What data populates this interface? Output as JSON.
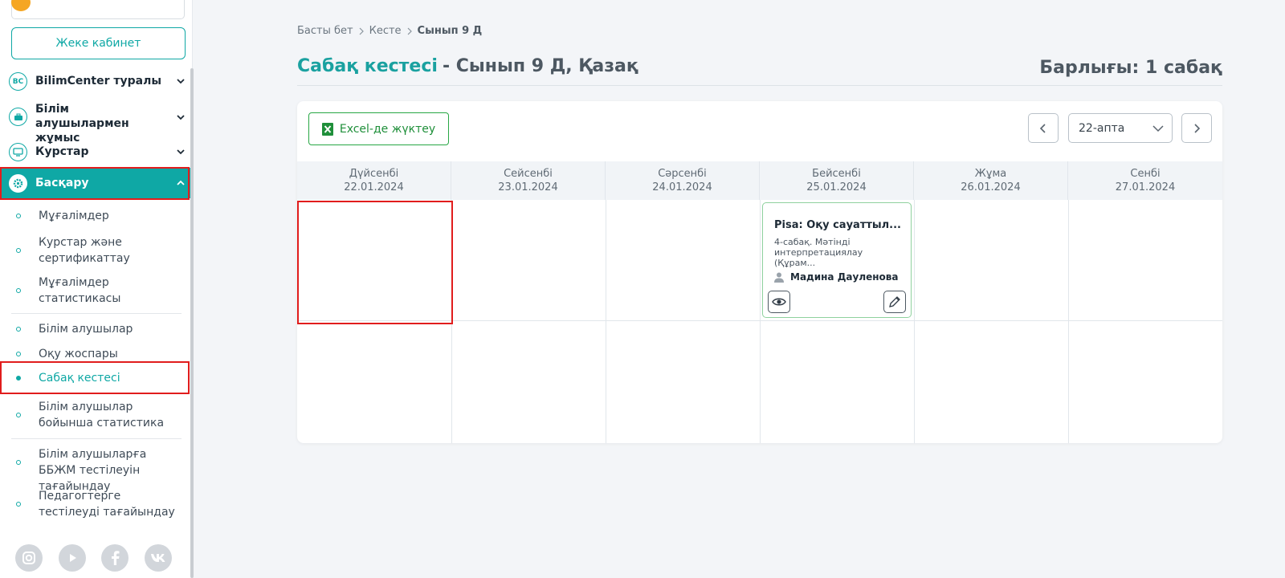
{
  "sidebar": {
    "cabinet_button": "Жеке кабинет",
    "menu": [
      {
        "label": "BilimCenter туралы",
        "icon": "bc-logo-icon"
      },
      {
        "label": "Білім алушылармен жұмыс",
        "icon": "briefcase-icon"
      },
      {
        "label": "Курстар",
        "icon": "monitor-icon"
      },
      {
        "label": "Басқару",
        "icon": "gear-icon"
      }
    ],
    "submenu_group1": [
      {
        "label": "Мұғалімдер"
      },
      {
        "label": "Курстар және сертификаттау"
      },
      {
        "label": "Мұғалімдер статистикасы"
      }
    ],
    "submenu_group2": [
      {
        "label": "Білім алушылар"
      },
      {
        "label": "Оқу жоспары"
      },
      {
        "label": "Сабақ кестесі"
      },
      {
        "label": "Білім алушылар бойынша статистика"
      }
    ],
    "submenu_group3": [
      {
        "label": "Білім алушыларға ББЖМ тестілеуін тағайындау"
      },
      {
        "label": "Педагогтерге тестілеуді тағайындау"
      }
    ],
    "social_icons": [
      "instagram-icon",
      "youtube-icon",
      "facebook-icon",
      "vk-icon"
    ]
  },
  "breadcrumb": {
    "home": "Басты бет",
    "section": "Кесте",
    "current": "Сынып 9 Д"
  },
  "header": {
    "title": "Сабақ кестесі",
    "subtitle": "- Сынып 9 Д, Қазақ",
    "total": "Барлығы: 1 сабақ"
  },
  "toolbar": {
    "excel_label": "Excel-де жүктеу",
    "week_value": "22-апта"
  },
  "schedule": {
    "days": [
      {
        "name": "Дүйсенбі",
        "date": "22.01.2024"
      },
      {
        "name": "Сейсенбі",
        "date": "23.01.2024"
      },
      {
        "name": "Сәрсенбі",
        "date": "24.01.2024"
      },
      {
        "name": "Бейсенбі",
        "date": "25.01.2024"
      },
      {
        "name": "Жұма",
        "date": "26.01.2024"
      },
      {
        "name": "Сенбі",
        "date": "27.01.2024"
      }
    ],
    "lesson": {
      "title": "Pisa: Оқу сауаттыл...",
      "description": "4-сабақ. Мәтінді интерпретациялау (Құрам...",
      "teacher": "Мадина Дауленова"
    }
  },
  "colors": {
    "accent": "#0fa8a5",
    "highlight": "#e11d1d",
    "excel_green": "#28a745"
  }
}
